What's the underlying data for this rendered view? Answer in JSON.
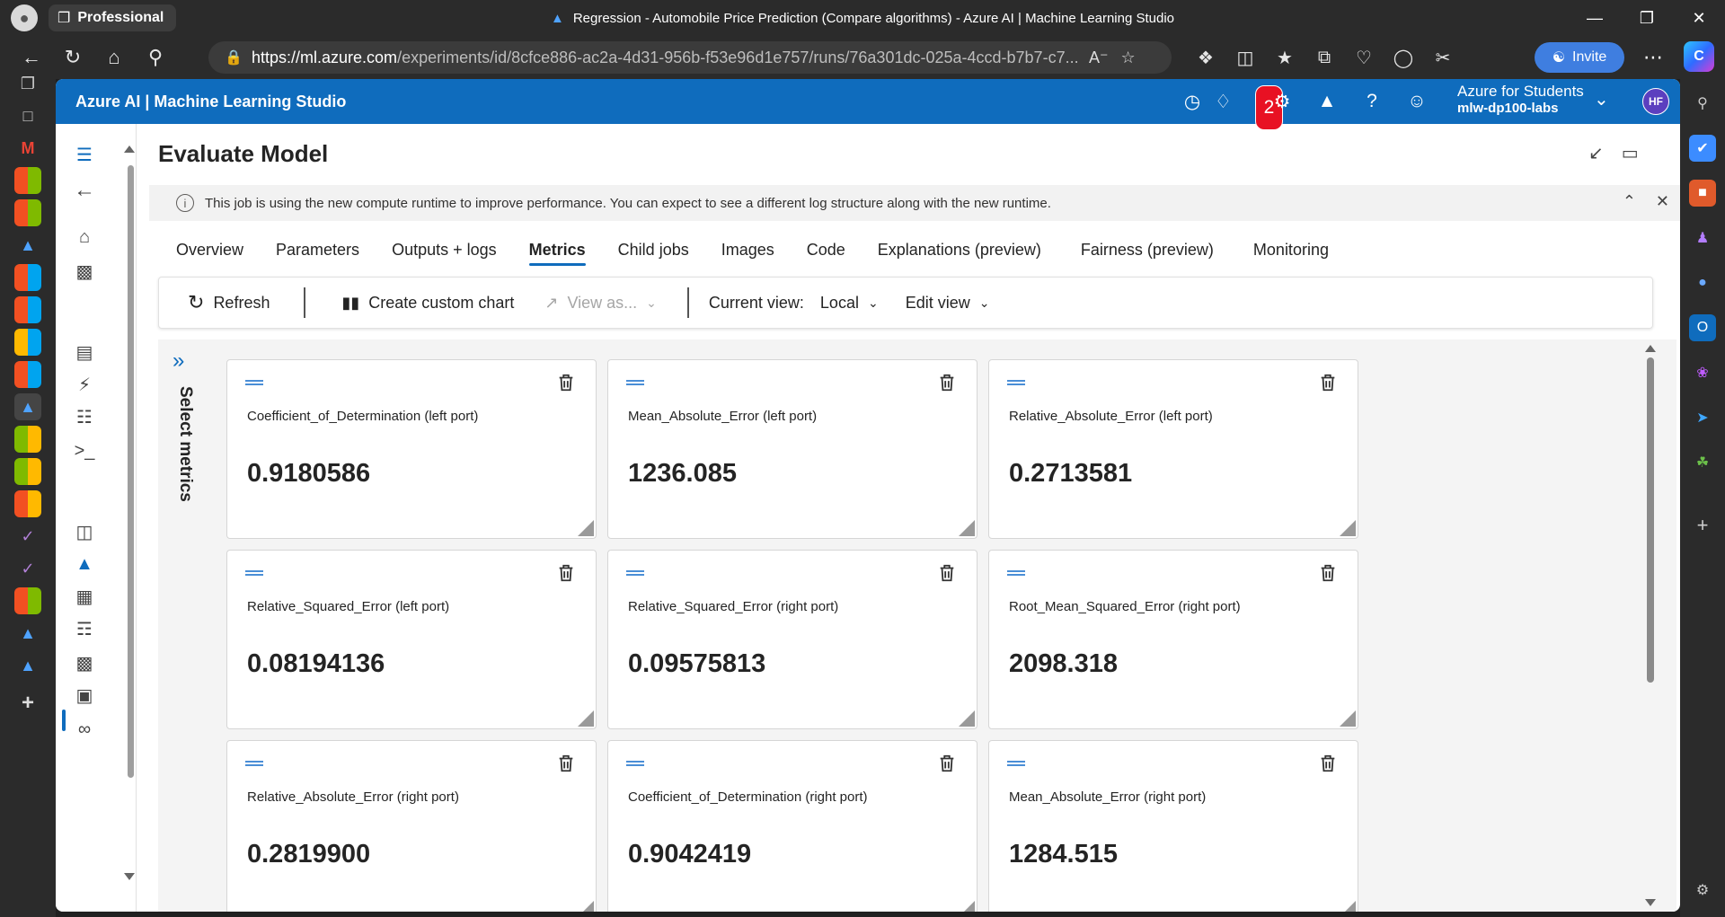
{
  "browser": {
    "profile_label": "Professional",
    "window_title": "Regression - Automobile Price Prediction (Compare algorithms) - Azure AI | Machine Learning Studio",
    "url_host": "https://ml.azure.com",
    "url_path": "/experiments/id/8cfce886-ac2a-4d31-956b-f53e96d1e757/runs/76a301dc-025a-4ccd-b7b7-c7...",
    "invite_label": "Invite"
  },
  "app": {
    "title": "Azure AI | Machine Learning Studio",
    "notification_count": "2",
    "tenant_name": "Azure for Students",
    "workspace_name": "mlw-dp100-labs",
    "user_initials": "HF",
    "accent_color": "#0f6cbd"
  },
  "page": {
    "title": "Evaluate Model",
    "banner_text": "This job is using the new compute runtime to improve performance. You can expect to see a different log structure along with the new runtime."
  },
  "tabs": [
    {
      "label": "Overview"
    },
    {
      "label": "Parameters"
    },
    {
      "label": "Outputs + logs"
    },
    {
      "label": "Metrics"
    },
    {
      "label": "Child jobs"
    },
    {
      "label": "Images"
    },
    {
      "label": "Code"
    },
    {
      "label": "Explanations (preview)"
    },
    {
      "label": "Fairness (preview)"
    },
    {
      "label": "Monitoring"
    }
  ],
  "toolbar": {
    "refresh_label": "Refresh",
    "create_chart_label": "Create custom chart",
    "view_as_label": "View as...",
    "current_view_label": "Current view:",
    "current_view_value": "Local",
    "edit_view_label": "Edit view"
  },
  "select_metrics_label": "Select metrics",
  "metrics": [
    {
      "name": "Coefficient_of_Determination (left port)",
      "value": "0.9180586"
    },
    {
      "name": "Mean_Absolute_Error (left port)",
      "value": "1236.085"
    },
    {
      "name": "Relative_Absolute_Error (left port)",
      "value": "0.2713581"
    },
    {
      "name": "Relative_Squared_Error (left port)",
      "value": "0.08194136"
    },
    {
      "name": "Relative_Squared_Error (right port)",
      "value": "0.09575813"
    },
    {
      "name": "Root_Mean_Squared_Error (right port)",
      "value": "2098.318"
    },
    {
      "name": "Relative_Absolute_Error (right port)",
      "value": "0.2819900"
    },
    {
      "name": "Coefficient_of_Determination (right port)",
      "value": "0.9042419"
    },
    {
      "name": "Mean_Absolute_Error (right port)",
      "value": "1284.515"
    }
  ]
}
